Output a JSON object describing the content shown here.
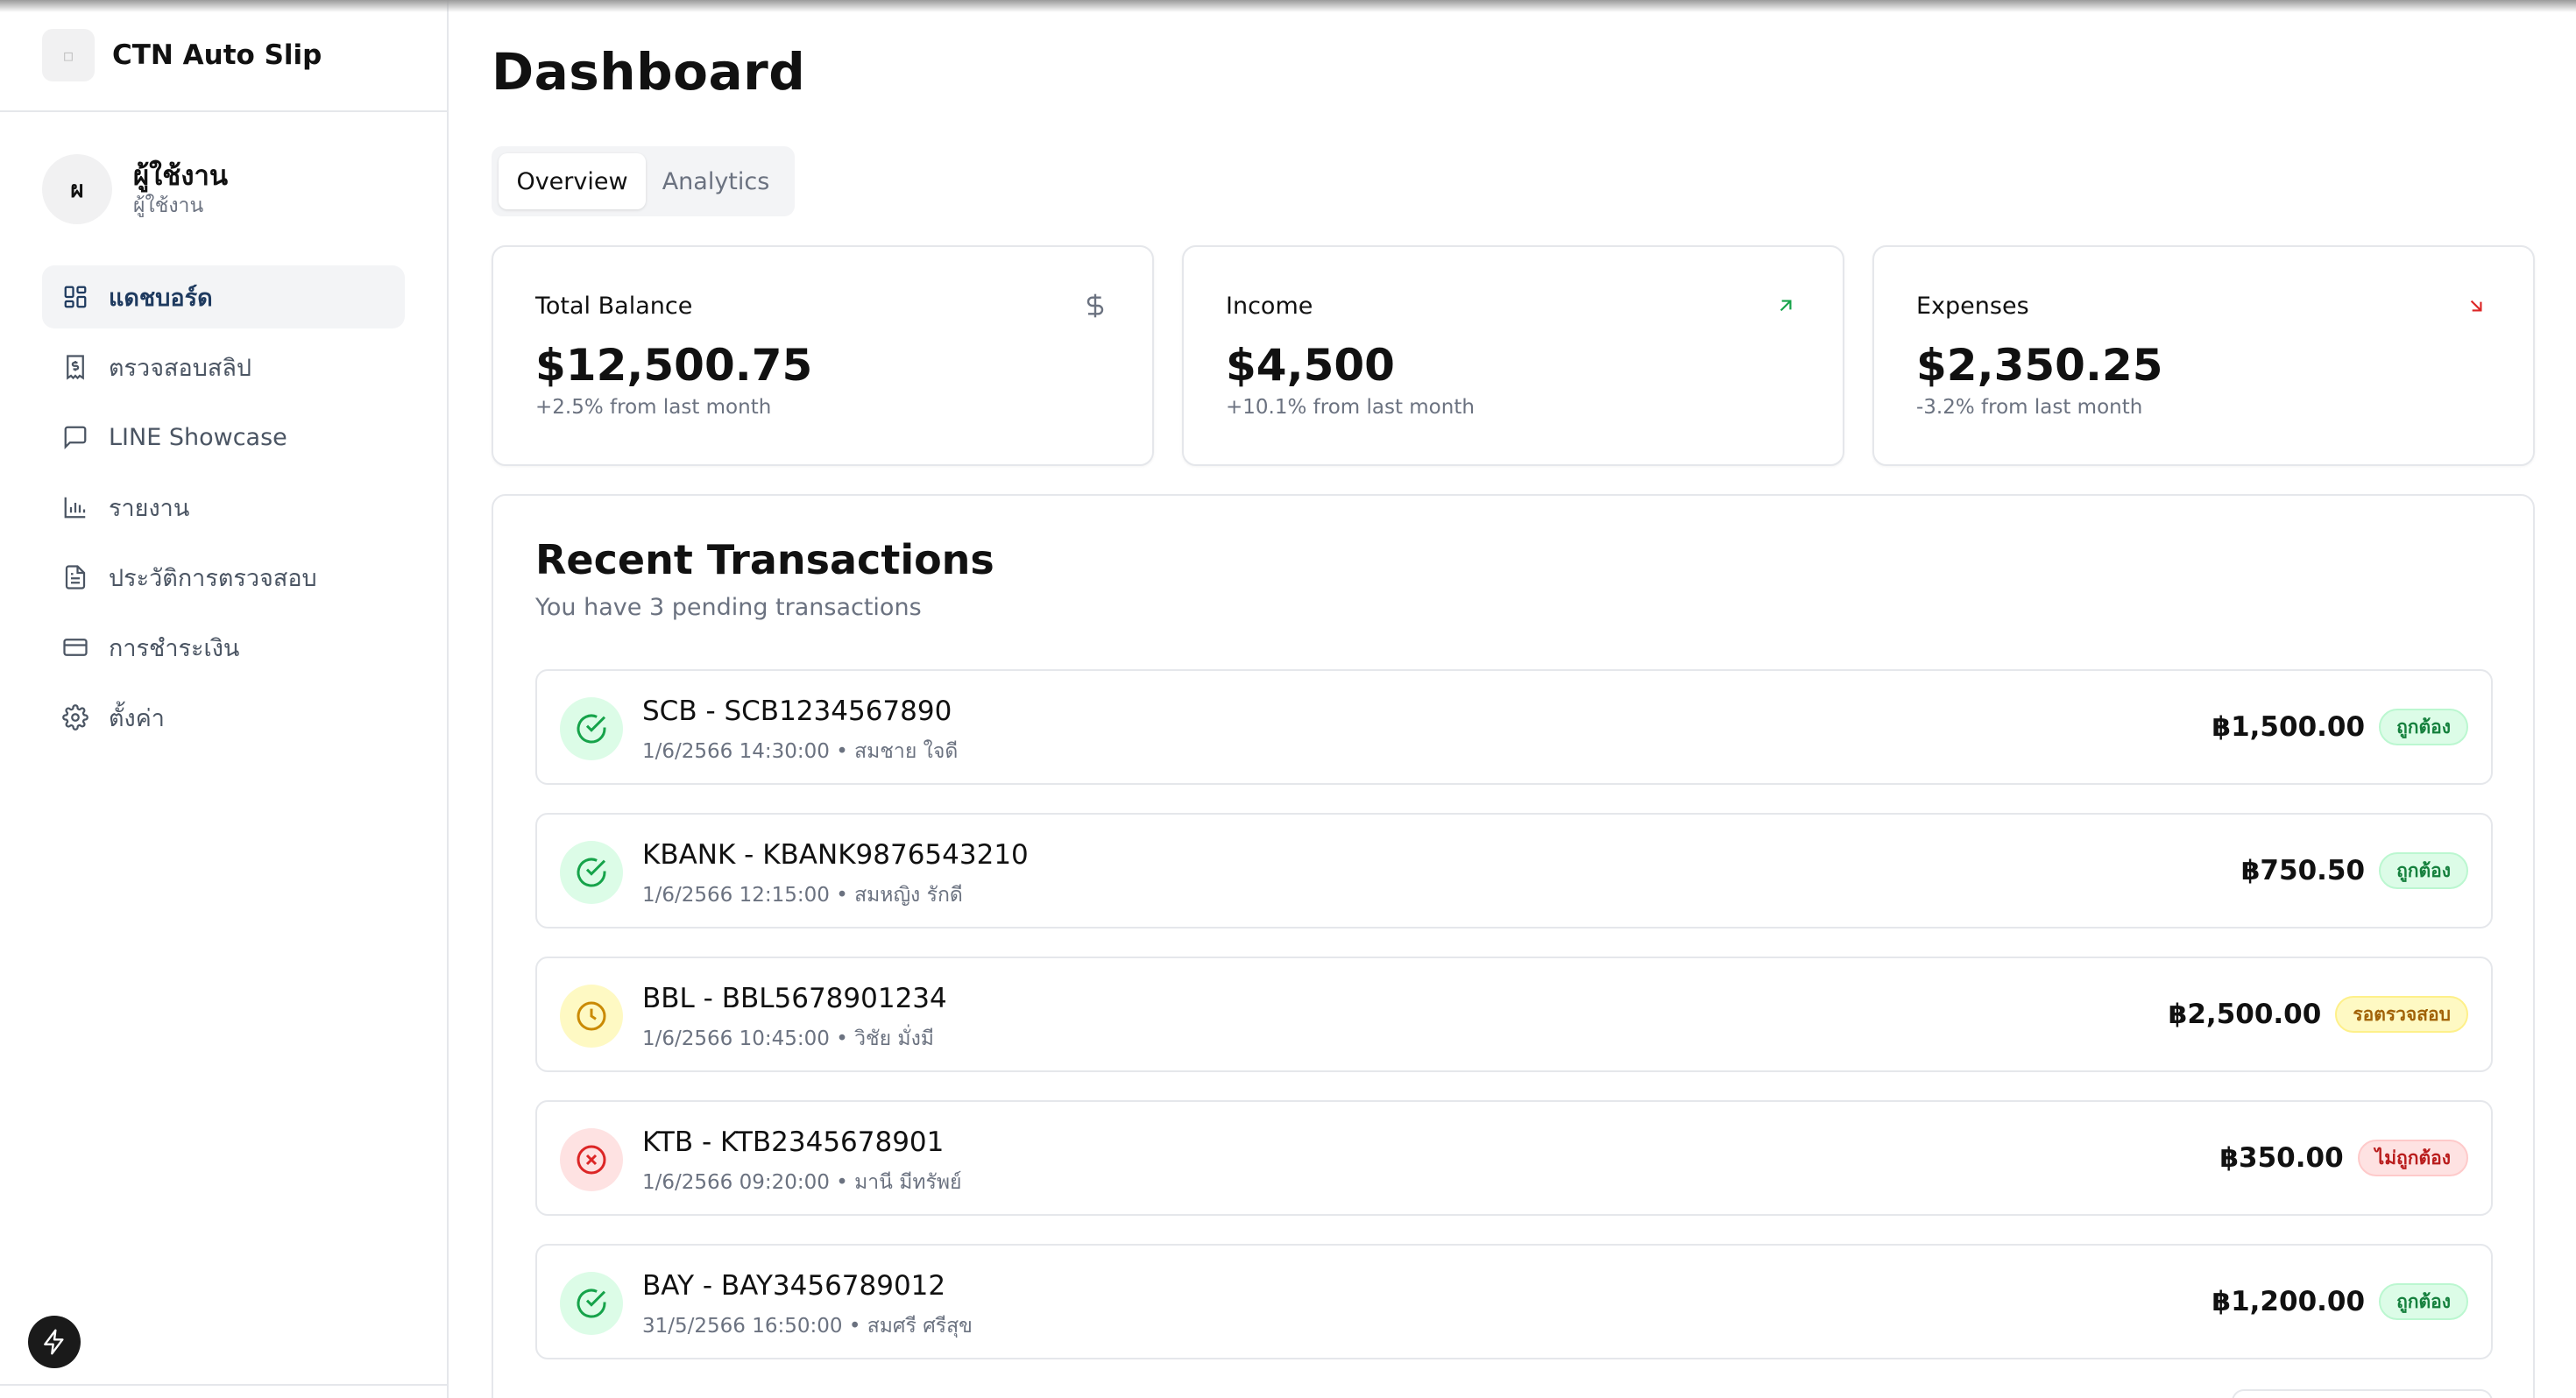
{
  "app": {
    "name": "CTN Auto Slip"
  },
  "profile": {
    "avatar_initial": "ผ",
    "name": "ผู้ใช้งาน",
    "role": "ผู้ใช้งาน"
  },
  "sidebar": {
    "items": [
      {
        "label": "แดชบอร์ด",
        "icon": "dashboard-icon",
        "active": true
      },
      {
        "label": "ตรวจสอบสลิป",
        "icon": "receipt-icon",
        "active": false
      },
      {
        "label": "LINE Showcase",
        "icon": "message-icon",
        "active": false
      },
      {
        "label": "รายงาน",
        "icon": "bar-chart-icon",
        "active": false
      },
      {
        "label": "ประวัติการตรวจสอบ",
        "icon": "file-text-icon",
        "active": false
      },
      {
        "label": "การชำระเงิน",
        "icon": "credit-card-icon",
        "active": false
      },
      {
        "label": "ตั้งค่า",
        "icon": "gear-icon",
        "active": false
      }
    ]
  },
  "page": {
    "title": "Dashboard"
  },
  "tabs": [
    {
      "label": "Overview",
      "active": true
    },
    {
      "label": "Analytics",
      "active": false
    }
  ],
  "stats": [
    {
      "label": "Total Balance",
      "value": "$12,500.75",
      "sub": "+2.5% from last month",
      "icon": "dollar-icon"
    },
    {
      "label": "Income",
      "value": "$4,500",
      "sub": "+10.1% from last month",
      "icon": "arrow-up-right-icon",
      "icon_color": "#16a34a"
    },
    {
      "label": "Expenses",
      "value": "$2,350.25",
      "sub": "-3.2% from last month",
      "icon": "arrow-down-right-icon",
      "icon_color": "#dc2626"
    }
  ],
  "transactions": {
    "title": "Recent Transactions",
    "subtitle": "You have 3 pending transactions",
    "items": [
      {
        "name": "SCB - SCB1234567890",
        "meta": "1/6/2566 14:30:00 • สมชาย ใจดี",
        "amount": "฿1,500.00",
        "status": "ถูกต้อง",
        "kind": "ok"
      },
      {
        "name": "KBANK - KBANK9876543210",
        "meta": "1/6/2566 12:15:00 • สมหญิง รักดี",
        "amount": "฿750.50",
        "status": "ถูกต้อง",
        "kind": "ok"
      },
      {
        "name": "BBL - BBL5678901234",
        "meta": "1/6/2566 10:45:00 • วิชัย มั่งมี",
        "amount": "฿2,500.00",
        "status": "รอตรวจสอบ",
        "kind": "wait"
      },
      {
        "name": "KTB - KTB2345678901",
        "meta": "1/6/2566 09:20:00 • มานี มีทรัพย์",
        "amount": "฿350.00",
        "status": "ไม่ถูกต้อง",
        "kind": "bad"
      },
      {
        "name": "BAY - BAY3456789012",
        "meta": "31/5/2566 16:50:00 • สมศรี ศรีสุข",
        "amount": "฿1,200.00",
        "status": "ถูกต้อง",
        "kind": "ok"
      }
    ]
  },
  "colors": {
    "success": "#16a34a",
    "warning": "#ca8a04",
    "danger": "#dc2626",
    "active_nav": "#1e3a5f"
  }
}
